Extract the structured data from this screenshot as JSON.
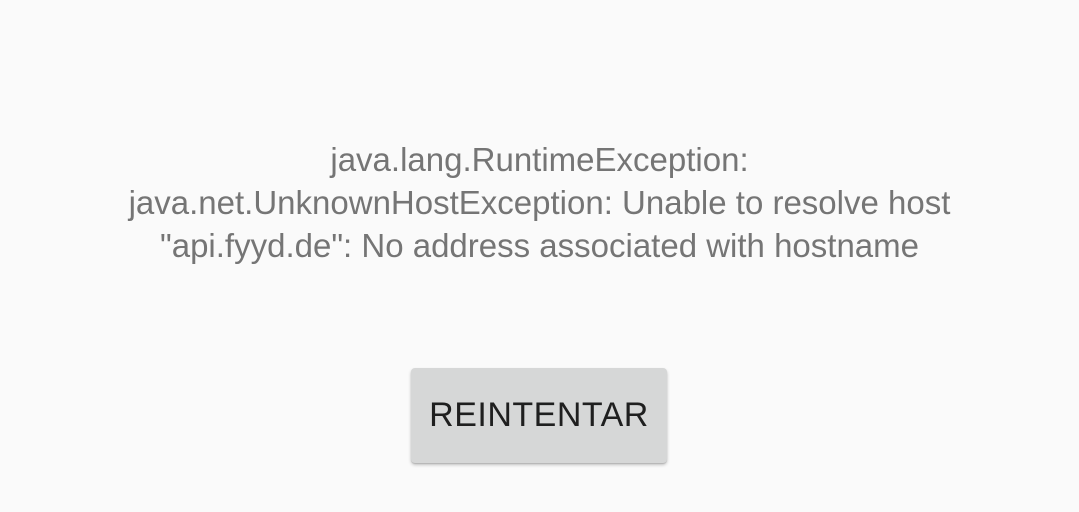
{
  "error": {
    "lines": [
      "java.lang.RuntimeException:",
      "java.net.UnknownHostException: Unable to resolve host",
      "\"api.fyyd.de\": No address associated with hostname"
    ]
  },
  "retry_button": {
    "label": "REINTENTAR"
  },
  "colors": {
    "background": "#fafafa",
    "message_text": "#757575",
    "button_background": "#d6d7d7",
    "button_text": "#1f1f1f"
  }
}
